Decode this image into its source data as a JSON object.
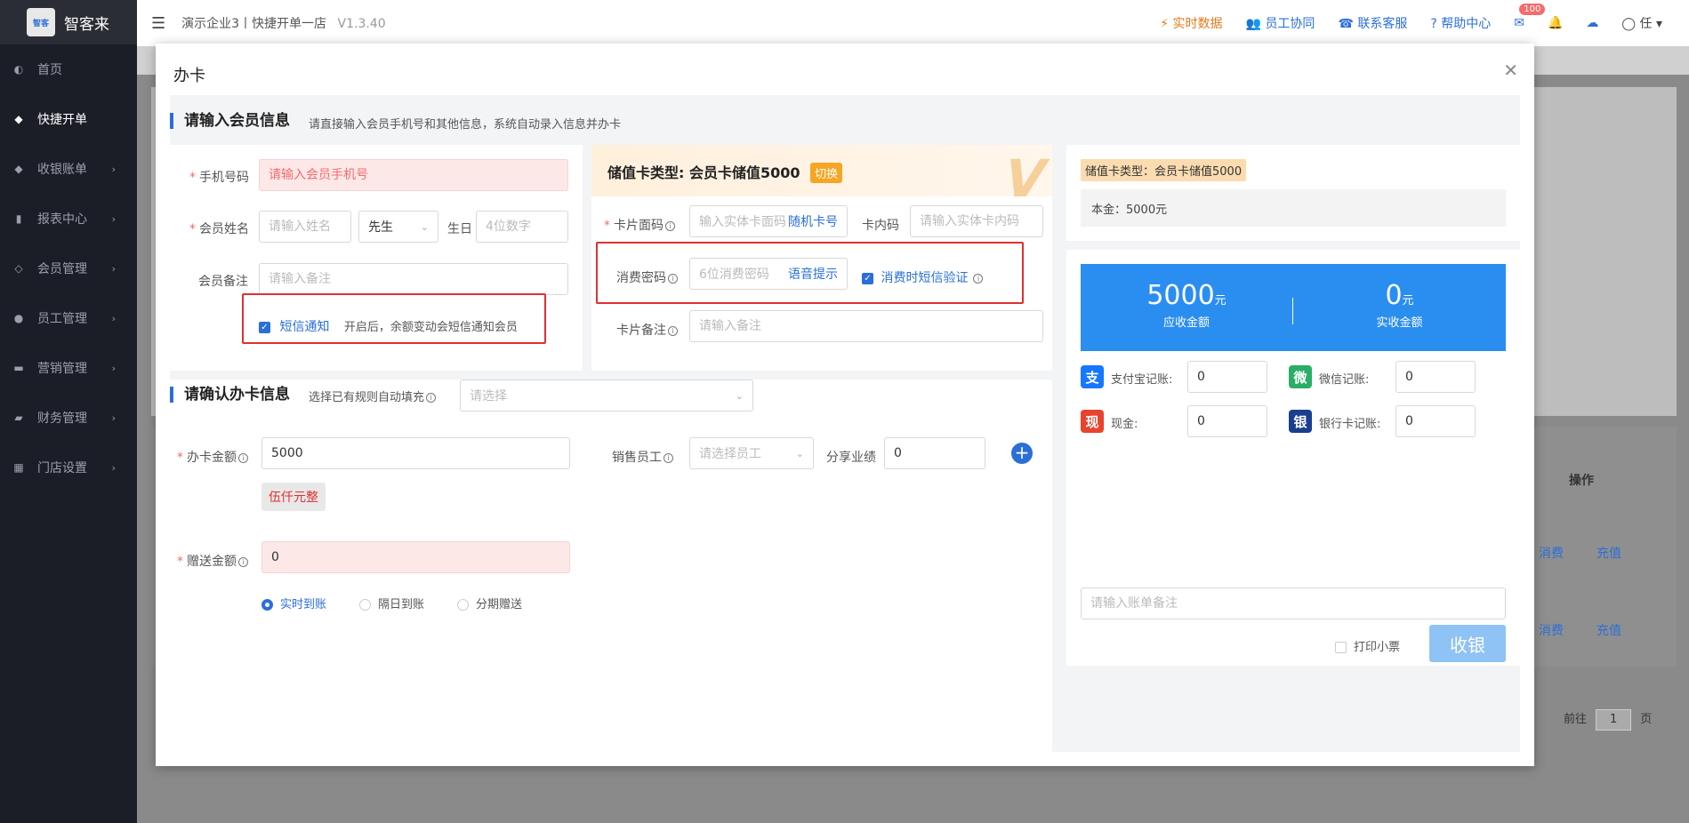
{
  "app": {
    "name": "智客来",
    "logo_text": "智客来"
  },
  "sidebar": {
    "items": [
      {
        "label": "首页",
        "icon": "dashboard-icon",
        "chevron": false
      },
      {
        "label": "快捷开单",
        "icon": "bag-icon",
        "chevron": false
      },
      {
        "label": "收银账单",
        "icon": "bag-icon",
        "chevron": true
      },
      {
        "label": "报表中心",
        "icon": "bar-chart-icon",
        "chevron": true
      },
      {
        "label": "会员管理",
        "icon": "diamond-icon",
        "chevron": true
      },
      {
        "label": "员工管理",
        "icon": "user-icon",
        "chevron": true
      },
      {
        "label": "营销管理",
        "icon": "briefcase-icon",
        "chevron": true
      },
      {
        "label": "财务管理",
        "icon": "wallet-icon",
        "chevron": true
      },
      {
        "label": "门店设置",
        "icon": "grid-icon",
        "chevron": true
      }
    ]
  },
  "header": {
    "breadcrumb": "演示企业3丨快捷开单一店",
    "version": "V1.3.40",
    "links": {
      "realtime": "实时数据",
      "staff": "员工协同",
      "support": "联系客服",
      "help": "帮助中心"
    },
    "mail_badge": "100",
    "user": "任"
  },
  "background": {
    "table_header_action": "操作",
    "row_actions": [
      "消费",
      "充值"
    ],
    "pager_prefix": "前往",
    "pager_page": "1",
    "pager_suffix": "页"
  },
  "modal": {
    "title": "办卡",
    "member_section": {
      "title": "请输入会员信息",
      "hint": "请直接输入会员手机号和其他信息，系统自动录入信息并办卡",
      "phone_label": "手机号码",
      "phone_placeholder": "请输入会员手机号",
      "name_label": "会员姓名",
      "name_placeholder": "请输入姓名",
      "title_select": "先生",
      "birthday_label": "生日",
      "birthday_placeholder": "4位数字",
      "remark_label": "会员备注",
      "remark_placeholder": "请输入备注",
      "sms_label": "短信通知",
      "sms_desc": "开启后，余额变动会短信通知会员"
    },
    "card": {
      "type_prefix": "储值卡类型: ",
      "type_name": "会员卡储值5000",
      "switch": "切换",
      "face_label": "卡片面码",
      "face_placeholder": "输入实体卡面码",
      "random": "随机卡号",
      "inner_label": "卡内码",
      "inner_placeholder": "请输入实体卡内码",
      "pwd_label": "消费密码",
      "pwd_placeholder": "6位消费密码",
      "voice": "语音提示",
      "sms_verify": "消费时短信验证",
      "remark_label": "卡片备注",
      "remark_placeholder": "请输入备注"
    },
    "confirm_section": {
      "title": "请确认办卡信息",
      "rule_label": "选择已有规则自动填充",
      "rule_placeholder": "请选择",
      "amount_label": "办卡金额",
      "amount_value": "5000",
      "amount_words": "伍仟元整",
      "seller_label": "销售员工",
      "seller_placeholder": "请选择员工",
      "share_label": "分享业绩",
      "share_value": "0",
      "gift_label": "赠送金额",
      "gift_value": "0",
      "radios": [
        "实时到账",
        "隔日到账",
        "分期赠送"
      ]
    },
    "summary": {
      "card_type": "储值卡类型：会员卡储值5000",
      "principal": "本金：5000元",
      "receivable": "5000",
      "receivable_unit": "元",
      "receivable_label": "应收金额",
      "received": "0",
      "received_unit": "元",
      "received_label": "实收金额",
      "payments": [
        {
          "label": "支付宝记账:",
          "value": "0",
          "icon": "alipay-icon",
          "glyph": "支",
          "color": "#1677ff"
        },
        {
          "label": "微信记账:",
          "value": "0",
          "icon": "wechat-icon",
          "glyph": "微",
          "color": "#2aae67"
        },
        {
          "label": "现金:",
          "value": "0",
          "icon": "cash-icon",
          "glyph": "现",
          "color": "#e8432f"
        },
        {
          "label": "银行卡记账:",
          "value": "0",
          "icon": "unionpay-icon",
          "glyph": "银",
          "color": "#1a3f8f"
        }
      ],
      "bill_remark_placeholder": "请输入账单备注",
      "print_label": "打印小票",
      "pay_button": "收银"
    }
  }
}
